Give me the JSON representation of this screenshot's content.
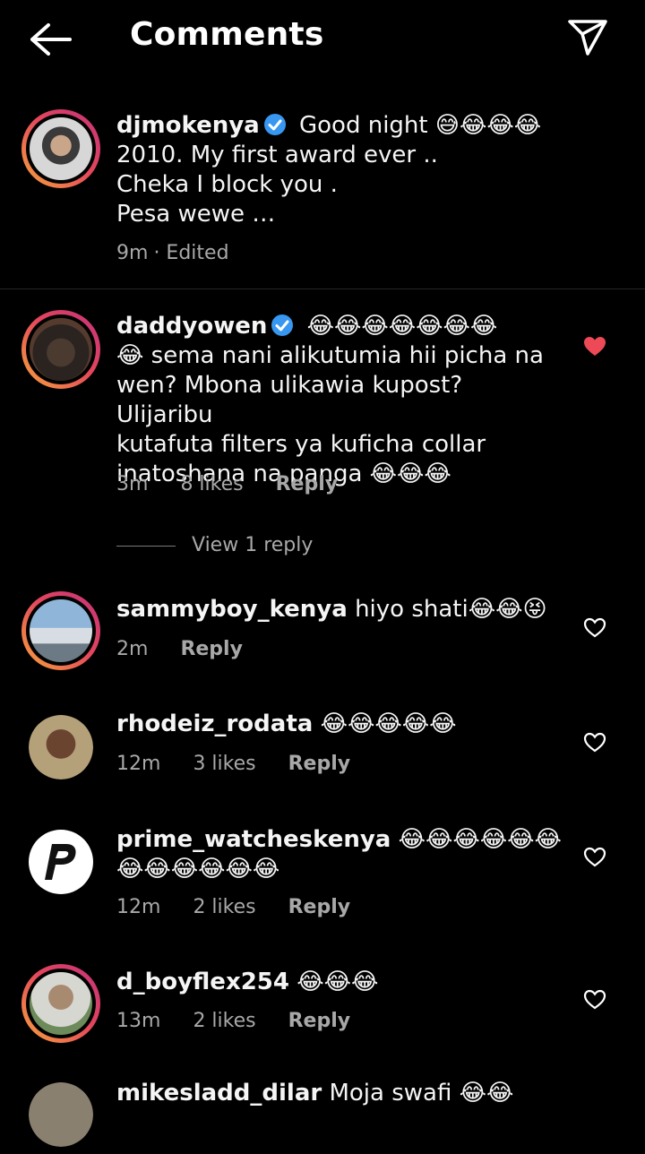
{
  "header": {
    "title": "Comments",
    "back_icon": "arrow-left-icon",
    "share_icon": "paper-plane-icon"
  },
  "caption": {
    "username": "djmokenya",
    "verified": true,
    "text_line1": "Good night",
    "emoji_line1": "😅😂😂😂",
    "text_line2": "2010. My first award ever ..",
    "text_line3": "Cheka I block you .",
    "text_line4": "Pesa wewe …",
    "time": "9m",
    "edited": "· Edited"
  },
  "comments": [
    {
      "username": "daddyowen",
      "verified": true,
      "emoji_lead": "😂😂😂😂😂😂😂",
      "line2_emoji": "😂",
      "line2": "sema nani alikutumia hii picha na",
      "line3": "wen? Mbona ulikawia kupost? Ulijaribu",
      "line4": "kutafuta filters ya kuficha collar",
      "line5": "inatoshana na panga",
      "line5_emoji": "😂😂😂",
      "time": "3m",
      "likes": "8 likes",
      "reply": "Reply",
      "liked": true,
      "view_replies": "View 1 reply"
    },
    {
      "username": "sammyboy_kenya",
      "text": "hiyo shati",
      "emoji": "😂😂😝",
      "time": "2m",
      "reply": "Reply",
      "liked": false
    },
    {
      "username": "rhodeiz_rodata",
      "emoji": "😂😂😂😂😂",
      "time": "12m",
      "likes": "3 likes",
      "reply": "Reply",
      "liked": false
    },
    {
      "username": "prime_watcheskenya",
      "emoji": "😂😂😂😂😂😂",
      "emoji_line2": "😂😂😂😂😂😂",
      "time": "12m",
      "likes": "2 likes",
      "reply": "Reply",
      "liked": false
    },
    {
      "username": "d_boyflex254",
      "emoji": "😂😂😂",
      "time": "13m",
      "likes": "2 likes",
      "reply": "Reply",
      "liked": false
    },
    {
      "username": "mikesladd_dilar",
      "text": "Moja swafi",
      "emoji": "😂😂"
    }
  ],
  "colors": {
    "background": "#000000",
    "liked_heart": "#ed4956",
    "muted_text": "#a8a8a8",
    "verified_badge": "#3897f0"
  }
}
